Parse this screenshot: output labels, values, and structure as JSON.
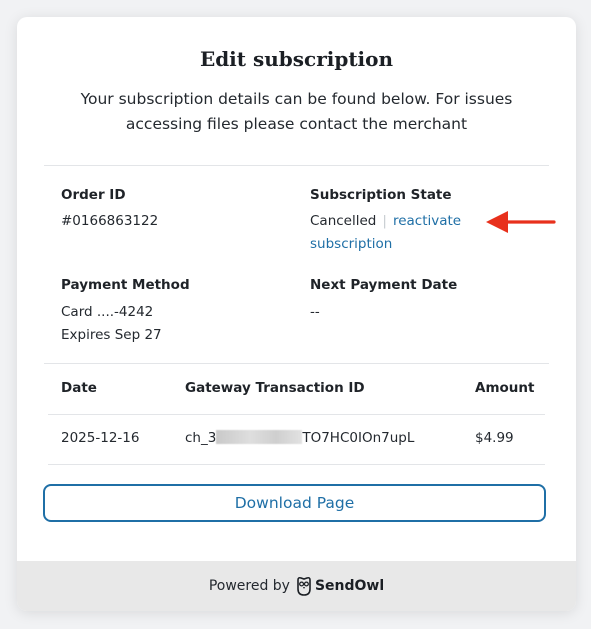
{
  "header": {
    "title": "Edit subscription",
    "subtitle": "Your subscription details can be found below. For issues accessing files please contact the merchant"
  },
  "order": {
    "label": "Order ID",
    "value": "#0166863122"
  },
  "subscription": {
    "label": "Subscription State",
    "state": "Cancelled",
    "separator": "|",
    "reactivate_link": "reactivate subscription"
  },
  "payment": {
    "label": "Payment Method",
    "card": "Card ....-4242",
    "expires": "Expires Sep 27"
  },
  "next_payment": {
    "label": "Next Payment Date",
    "value": "--"
  },
  "table": {
    "headers": [
      "Date",
      "Gateway Transaction ID",
      "Amount"
    ],
    "rows": [
      {
        "date": "2025-12-16",
        "txn_prefix": "ch_3",
        "txn_suffix": "TO7HC0IOn7upL",
        "amount": "$4.99"
      }
    ]
  },
  "actions": {
    "download_label": "Download Page"
  },
  "footer": {
    "powered_by": "Powered by",
    "brand": "SendOwl"
  },
  "icons": {
    "annotation": "red-arrow-icon",
    "brand_logo": "owl-icon"
  },
  "colors": {
    "link": "#1f6fa6",
    "annotation_arrow": "#e8301c",
    "footer_bg": "#e8e8e8"
  }
}
